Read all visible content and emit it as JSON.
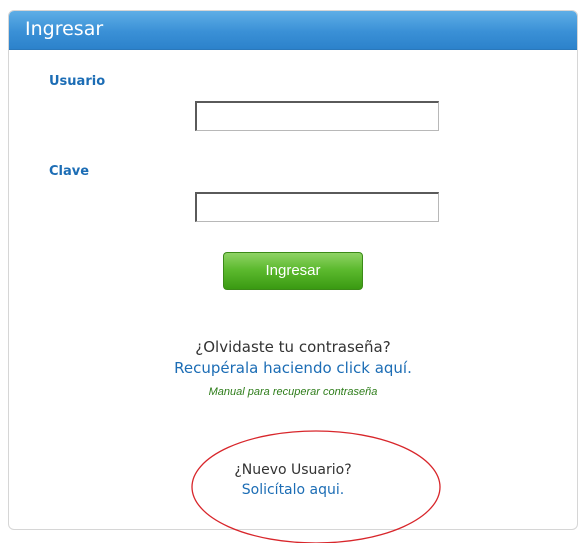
{
  "panel": {
    "title": "Ingresar"
  },
  "form": {
    "username_label": "Usuario",
    "username_value": "",
    "password_label": "Clave",
    "password_value": "",
    "submit_label": "Ingresar"
  },
  "recovery": {
    "question": "¿Olvidaste tu contraseña?",
    "link": "Recupérala haciendo click aquí.",
    "manual_link": "Manual para recuperar contraseña"
  },
  "new_user": {
    "question": "¿Nuevo Usuario?",
    "link": "Solicítalo aqui."
  },
  "colors": {
    "header": "#3a90d6",
    "label": "#1c6db5",
    "button": "#5dba2f",
    "highlight": "#d8262b"
  }
}
